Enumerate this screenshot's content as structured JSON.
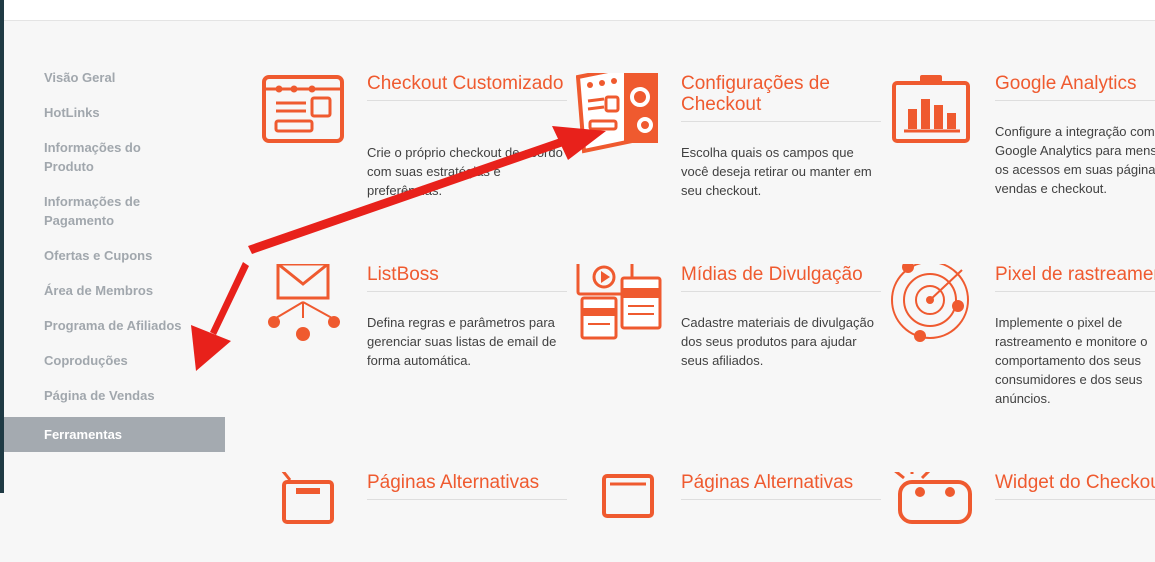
{
  "sidebar": {
    "items": [
      {
        "label": "Visão Geral"
      },
      {
        "label": "HotLinks"
      },
      {
        "label": "Informações do Produto"
      },
      {
        "label": "Informações de Pagamento"
      },
      {
        "label": "Ofertas e Cupons"
      },
      {
        "label": "Área de Membros"
      },
      {
        "label": "Programa de Afiliados"
      },
      {
        "label": "Coproduções"
      },
      {
        "label": "Página de Vendas"
      },
      {
        "label": "Ferramentas"
      }
    ]
  },
  "tools": [
    {
      "title": "Checkout Customizado",
      "desc": "Crie o próprio checkout de acordo com suas estratégias e preferências.",
      "icon": "checkout-custom-icon"
    },
    {
      "title": "Configurações de Checkout",
      "desc": "Escolha quais os campos que você deseja retirar ou manter em seu checkout.",
      "icon": "checkout-settings-icon"
    },
    {
      "title": "Google Analytics",
      "desc": "Configure a integração com o Google Analytics para mensurar os acessos em suas páginas de vendas e checkout.",
      "icon": "analytics-icon"
    },
    {
      "title": "ListBoss",
      "desc": "Defina regras e parâmetros para gerenciar suas listas de email de forma automática.",
      "icon": "email-list-icon"
    },
    {
      "title": "Mídias de Divulgação",
      "desc": "Cadastre materiais de divulgação dos seus produtos para ajudar seus afiliados.",
      "icon": "media-icon"
    },
    {
      "title": "Pixel de rastreamento",
      "desc": "Implemente o pixel de rastreamento e monitore o comportamento dos seus consumidores e dos seus anúncios.",
      "icon": "pixel-target-icon"
    },
    {
      "title": "Páginas Alternativas",
      "desc": "",
      "icon": "alt-pages-icon"
    },
    {
      "title": "Páginas Alternativas",
      "desc": "",
      "icon": "alt-pages-2-icon"
    },
    {
      "title": "Widget do Checkout",
      "desc": "",
      "icon": "widget-icon"
    }
  ],
  "colors": {
    "accent": "#ef5a2f",
    "annotation": "#e8211b"
  }
}
